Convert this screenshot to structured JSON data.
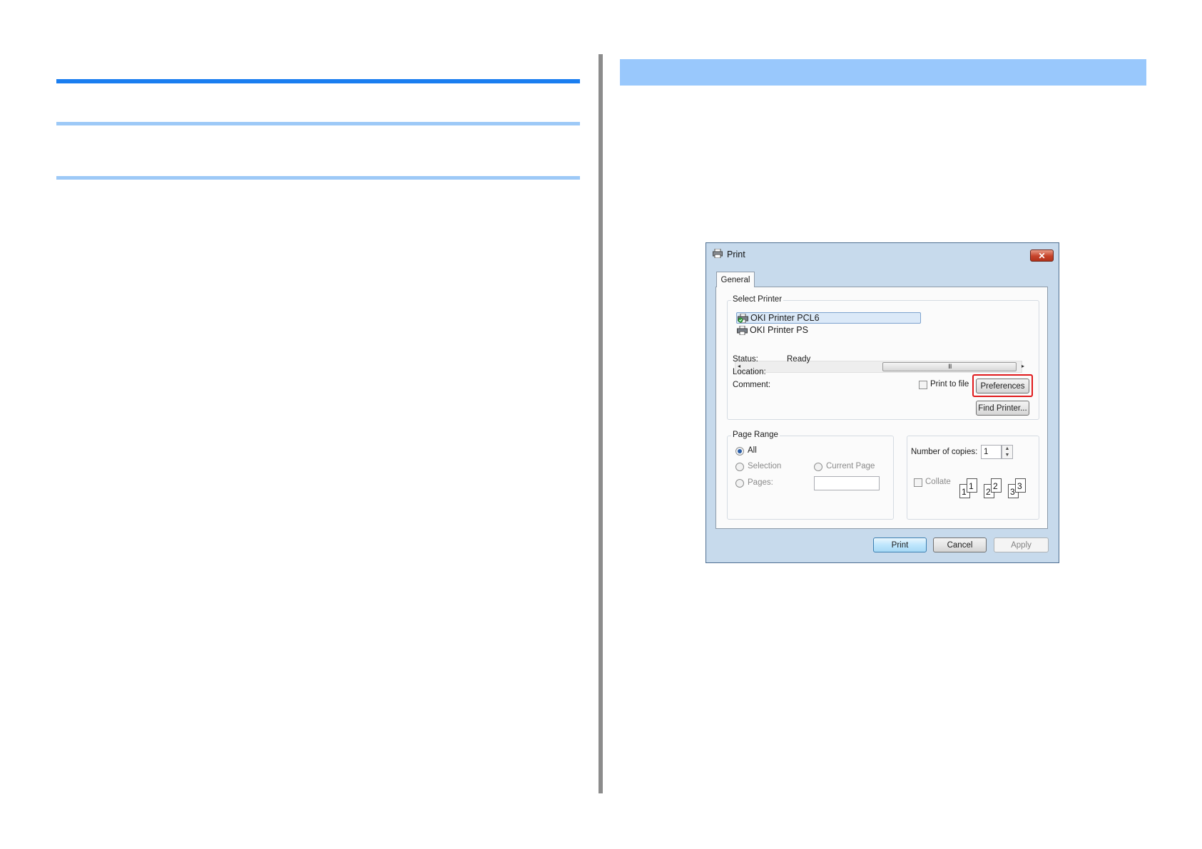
{
  "dialog": {
    "title": "Print",
    "close_symbol": "✕",
    "tab": "General",
    "select_printer": {
      "label": "Select Printer",
      "printers": [
        {
          "name": "OKI Printer PCL6",
          "selected": true,
          "icon": "printer-default-icon"
        },
        {
          "name": "OKI Printer PS",
          "selected": false,
          "icon": "printer-icon"
        }
      ],
      "scroll_left": "◂",
      "scroll_right": "▸",
      "scroll_grip": "III"
    },
    "status": {
      "label": "Status:",
      "value": "Ready"
    },
    "location": {
      "label": "Location:",
      "value": ""
    },
    "comment": {
      "label": "Comment:",
      "value": ""
    },
    "print_to_file": {
      "label": "Print to file",
      "checked": false
    },
    "preferences_label": "Preferences",
    "find_printer_label": "Find Printer...",
    "page_range": {
      "label": "Page Range",
      "all": "All",
      "selection": "Selection",
      "current_page": "Current Page",
      "pages": "Pages:",
      "pages_value": ""
    },
    "copies": {
      "label": "Number of copies:",
      "value": "1",
      "collate_label": "Collate",
      "collate_checked": false,
      "collate_sheets": [
        "1",
        "1",
        "2",
        "2",
        "3",
        "3"
      ]
    },
    "buttons": {
      "print": "Print",
      "cancel": "Cancel",
      "apply": "Apply"
    }
  },
  "colors": {
    "primary_rule": "#1a7ef0",
    "secondary_rule": "#9dc9f7",
    "header_band": "#99c8fc",
    "highlight": "#e0191b"
  }
}
